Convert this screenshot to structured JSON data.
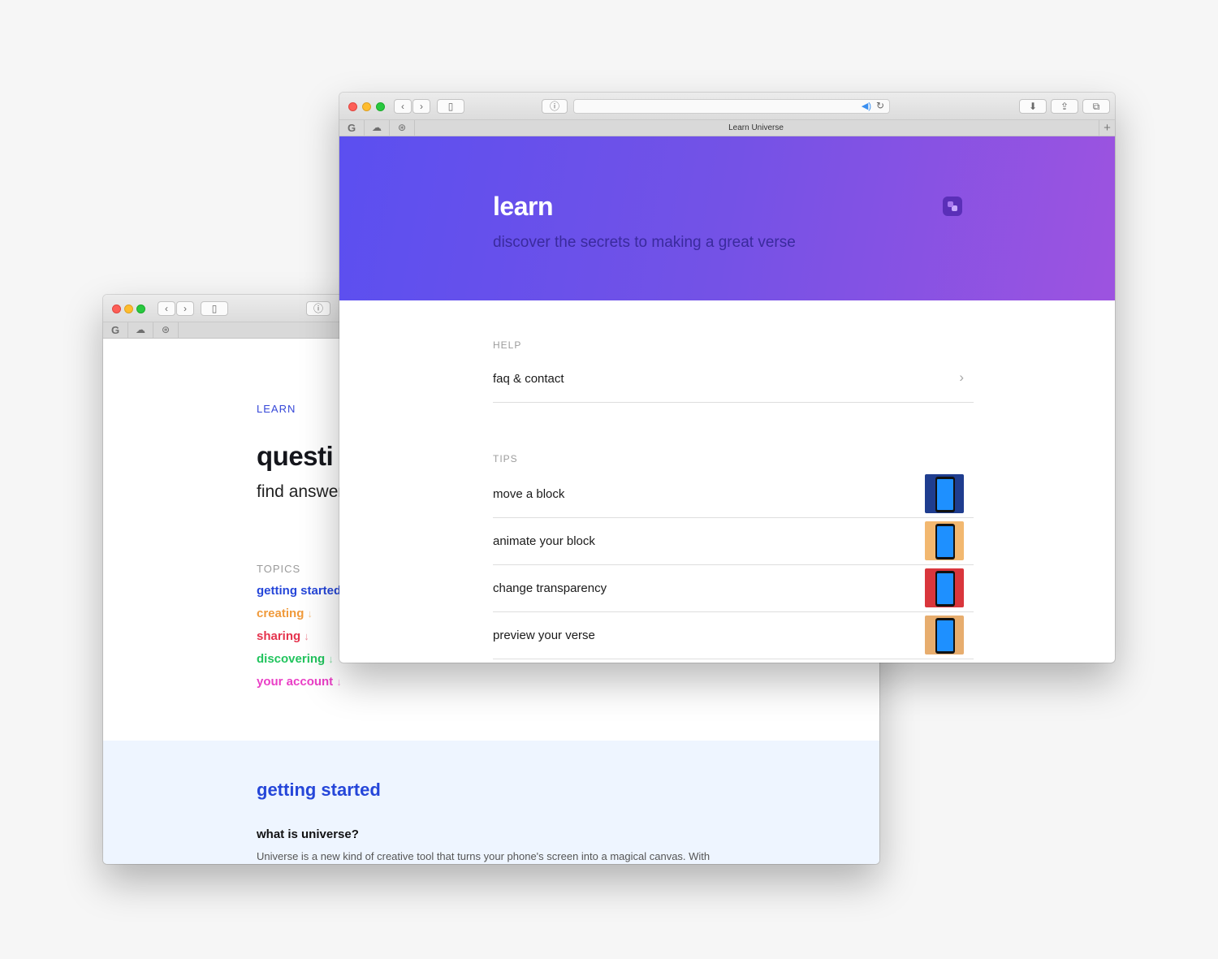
{
  "back_window": {
    "learn_label": "LEARN",
    "title": "questi",
    "subtitle": "find answer",
    "topics_label": "TOPICS",
    "topics": [
      {
        "label": "getting started",
        "arrow": "",
        "color": "#2546d9"
      },
      {
        "label": "creating",
        "arrow": "↓",
        "color": "#f09a3b"
      },
      {
        "label": "sharing",
        "arrow": "↓",
        "color": "#e5334d"
      },
      {
        "label": "discovering",
        "arrow": "↓",
        "color": "#22c45e"
      },
      {
        "label": "your account",
        "arrow": "↓",
        "color": "#ea3fc6"
      }
    ],
    "section": {
      "title": "getting started",
      "question": "what is universe?",
      "answer": "Universe is a new kind of creative tool that turns your phone's screen into a magical canvas. With"
    }
  },
  "front_window": {
    "tab_title": "Learn Universe",
    "hero": {
      "title": "learn",
      "subtitle": "discover the secrets to making a great verse"
    },
    "help": {
      "label": "HELP",
      "items": [
        {
          "label": "faq & contact"
        }
      ]
    },
    "tips": {
      "label": "TIPS",
      "items": [
        {
          "label": "move a block",
          "thumb_bg": "#1f3d8f"
        },
        {
          "label": "animate your block",
          "thumb_bg": "#f2b870"
        },
        {
          "label": "change transparency",
          "thumb_bg": "#d9363c"
        },
        {
          "label": "preview your verse",
          "thumb_bg": "#e7ad6e"
        }
      ]
    }
  },
  "icons": {
    "back": "‹",
    "forward": "›",
    "sidebar": "▯",
    "reader": "ⓘ",
    "favorite_google": "G",
    "favorite_cloud": "☁",
    "favorite_dribbble": "⊛",
    "download": "⬇",
    "share": "⇪",
    "tabs": "⧉",
    "sound": "◀)",
    "reload": "↻",
    "new_tab": "+",
    "chevron_right": "›"
  }
}
